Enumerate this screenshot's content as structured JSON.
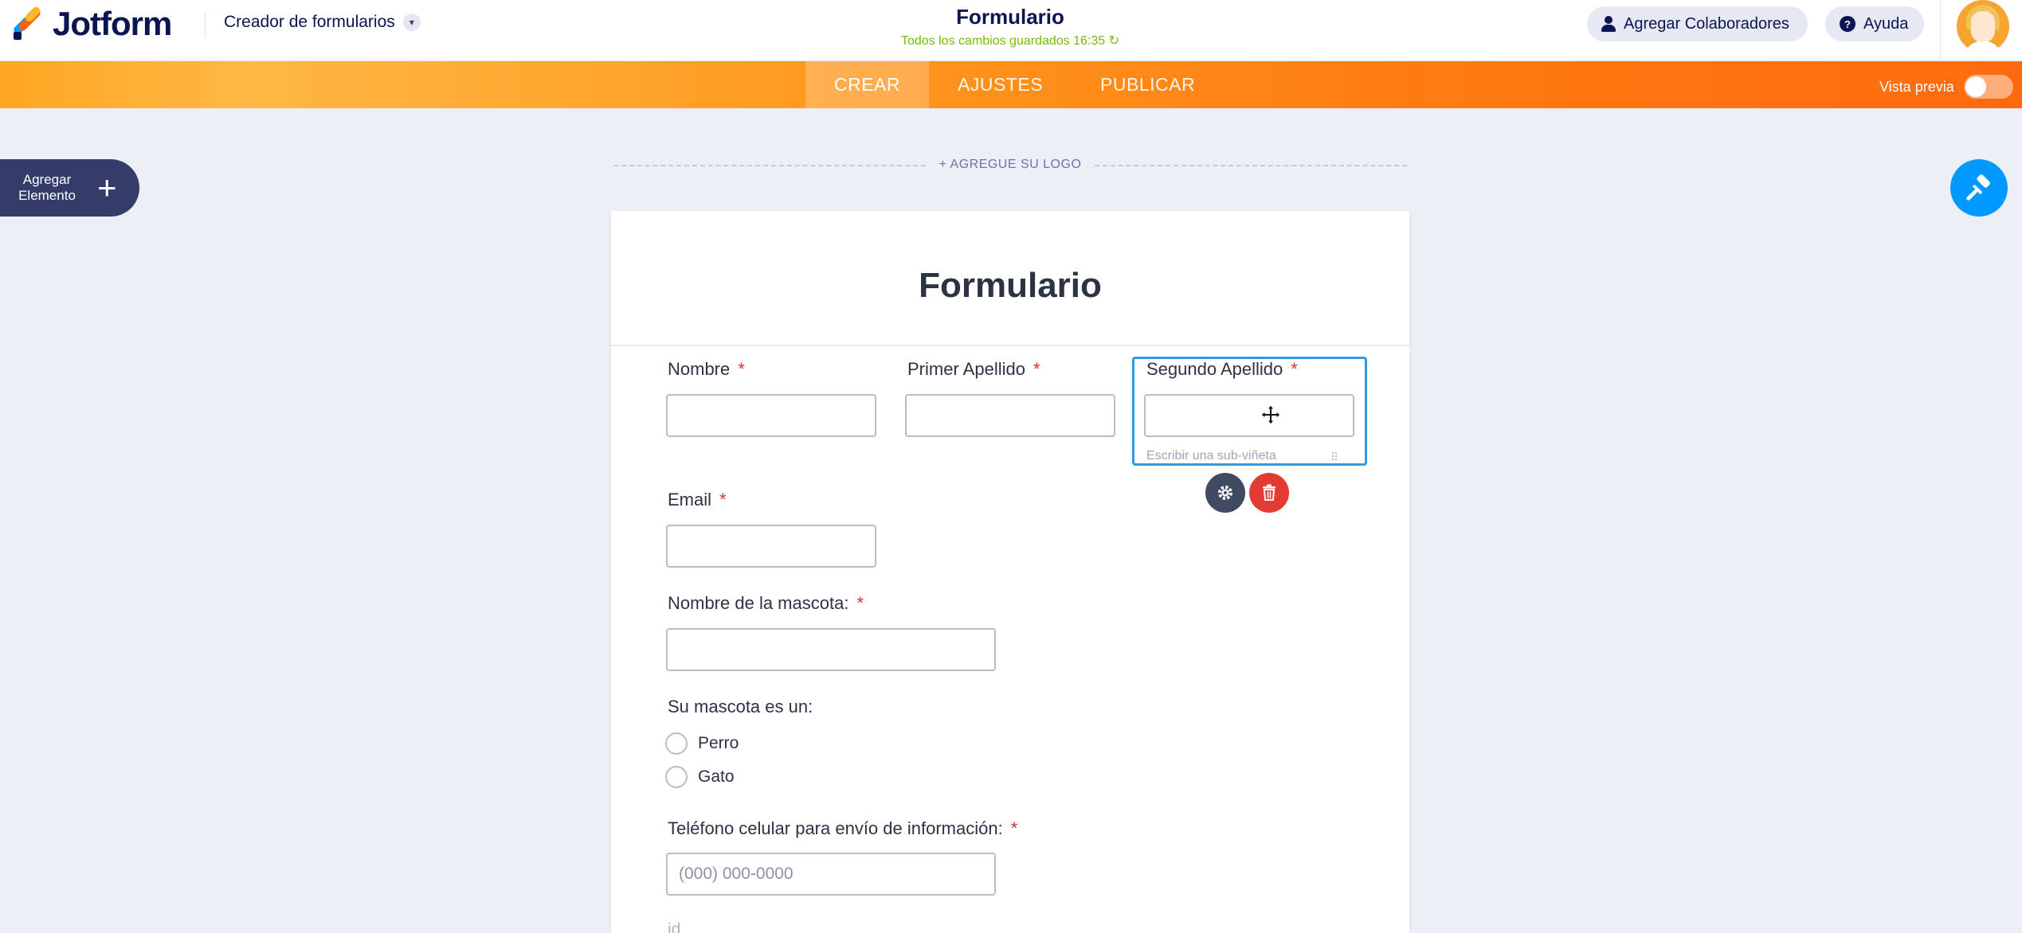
{
  "header": {
    "brand": "Jotform",
    "builder_menu": "Creador de formularios",
    "form_title": "Formulario",
    "save_status": "Todos los cambios guardados 16:35",
    "collab_label": "Agregar Colaboradores",
    "help_label": "Ayuda"
  },
  "nav": {
    "tabs": [
      {
        "label": "CREAR"
      },
      {
        "label": "AJUSTES"
      },
      {
        "label": "PUBLICAR"
      }
    ],
    "preview_label": "Vista previa"
  },
  "sidebar": {
    "add_element_label": "Agregar\nElemento",
    "plus": "+"
  },
  "builder": {
    "add_logo": "+ AGREGUE SU LOGO",
    "heading": "Formulario",
    "required_mark": "*",
    "fields": {
      "nombre": "Nombre",
      "primer_apellido": "Primer Apellido",
      "segundo_apellido": "Segundo Apellido",
      "sub_label_placeholder": "Escribir una sub-viñeta",
      "email": "Email",
      "mascota_nombre": "Nombre de la mascota:",
      "mascota_tipo": "Su mascota es un:",
      "options": [
        "Perro",
        "Gato"
      ],
      "telefono": "Teléfono celular para envío de información:",
      "telefono_placeholder": "(000) 000-0000",
      "cut_label": "id"
    }
  },
  "colors": {
    "brand_navy": "#0a1551",
    "nav_orange": "#ff7b12",
    "accent_blue": "#0099ff",
    "selection_blue": "#2e9be3",
    "delete_red": "#e23b32",
    "save_green": "#78bb07"
  }
}
